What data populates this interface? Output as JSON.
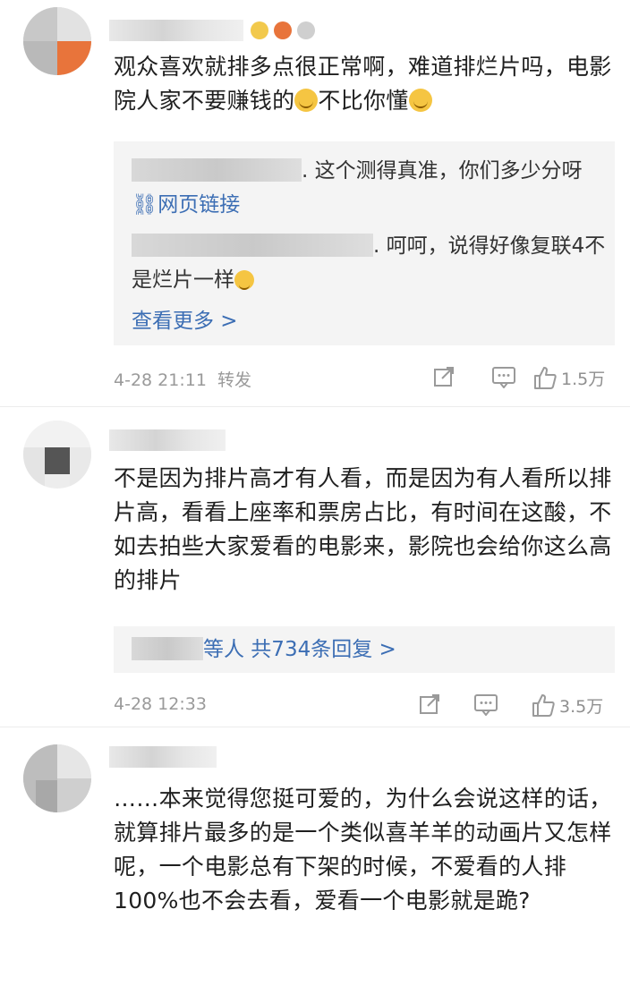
{
  "comments": [
    {
      "text": "观众喜欢就排多点很正常啊，难道排烂片吗，电影院人家不要赚钱的",
      "text_tail": "不比你懂",
      "replies": {
        "r1_text": ". 这个测得真准，你们多少分呀",
        "r1_link": "网页链接",
        "r2_text": ". 呵呵，说得好像复联4不是烂片一样",
        "more": "查看更多 >"
      },
      "time": "4-28 21:11",
      "repost": "转发",
      "likes": "1.5万",
      "icons": [
        "share-icon",
        "comment-icon",
        "like-icon"
      ]
    },
    {
      "text": "不是因为排片高才有人看，而是因为有人看所以排片高，看看上座率和票房占比，有时间在这酸，不如去拍些大家爱看的电影来，影院也会给你这么高的排片",
      "replies": {
        "summary": "等人 共734条回复 >"
      },
      "time": "4-28 12:33",
      "likes": "3.5万",
      "icons": [
        "share-icon",
        "comment-icon",
        "like-icon"
      ]
    },
    {
      "text": "……本来觉得您挺可爱的，为什么会说这样的话，就算排片最多的是一个类似喜羊羊的动画片又怎样呢，一个电影总有下架的时候，不爱看的人排100%也不会去看，爱看一个电影就是跪?"
    }
  ],
  "colors": {
    "link": "#3c6eb4",
    "reply_bg": "#f4f4f4",
    "meta": "#9a9a9a"
  }
}
